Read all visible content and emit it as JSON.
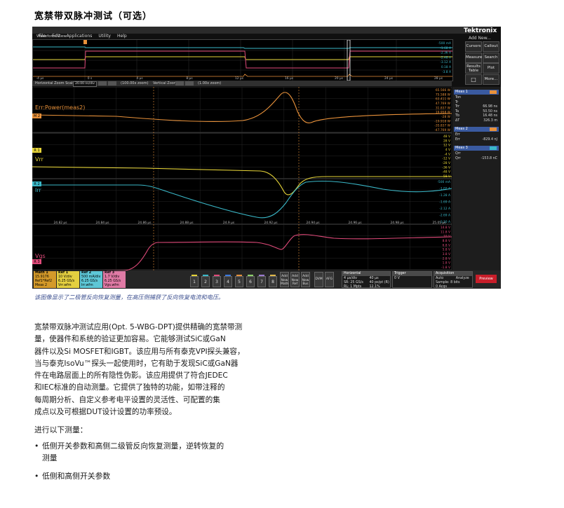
{
  "page": {
    "title": "宽禁带双脉冲测试（可选）",
    "caption": "该图像显示了二极管反向恢复测量，在高压侧捕获了反向恢复电流和电压。",
    "paragraph_lines": [
      "宽禁带双脉冲测试应用(Opt. 5-WBG-DPT)提供精确的宽禁带测",
      "量，使器件和系统的验证更加容易。它能够测试SiC或GaN",
      "器件以及Si MOSFET和IGBT。该应用与所有泰克VPI探头兼容，",
      "当与泰克IsoVu™探头一起使用时，它有助于发现SiC或GaN器",
      "件在电路层面上的所有隐性伪影。该应用提供了符合JEDEC",
      "和IEC标准的自动测量。它提供了独特的功能，如带注释的",
      "每周期分析、自定义参考电平设置的灵活性、可配置的集",
      "成点以及可根据DUT设计设置的功率预设。"
    ],
    "measure_intro": "进行以下测量：",
    "bullets": [
      {
        "dot": "•",
        "lines": [
          "低侧开关参数和高侧二级管反向恢复测量，逆转恢复的",
          "测量"
        ]
      },
      {
        "dot": "•",
        "lines": [
          "低侧和高侧开关参数"
        ]
      }
    ]
  },
  "scope": {
    "menu": [
      "File",
      "Edit",
      "Applications",
      "Utility",
      "Help"
    ],
    "logo": "Tektronix",
    "add_new": "Add New...",
    "right_buttons": [
      "Cursors",
      "Callout",
      "Measure",
      "Search",
      "Results Table",
      "Plot",
      "More..."
    ],
    "waveform_view_label": "Waveform View",
    "wf_time_ticks": [
      "-4 μs",
      "0 s",
      "4 μs",
      "8 μs",
      "12 μs",
      "16 μs",
      "20 μs",
      "24 μs",
      "28 μs"
    ],
    "wf_right_labels": [
      "-500 mA",
      "-1.68 A",
      "-2.36 A",
      "-2.48 A",
      "-3.12 A",
      "0.18 A",
      "-3.8 A"
    ],
    "zoom_bar": {
      "hzoom_label": "Horizontal Zoom Scale",
      "hzoom_value": "20.00 ns/div",
      "pos_label": "(100.00x zoom)",
      "vzoom_label": "Vertical Zoom",
      "vzoom_value": "(1.00x zoom)"
    },
    "panels": [
      {
        "name": "Err:Power(meas2)",
        "marker": "M 2",
        "color": "#e8913a",
        "y_labels": [
          "65.566 W",
          "75.588 W",
          "63.411 W",
          "47.769 W",
          "31.837 W",
          "19.958 W",
          "-28 W",
          "-19.918 W",
          "-35.837 W",
          "-47.769 W"
        ]
      },
      {
        "name": "Vrr",
        "marker": "R 1",
        "color": "#e6d438",
        "y_labels": [
          "48 V",
          "28 V",
          "12 V",
          "4 V",
          "-4 V",
          "-12 V",
          "-28 V",
          "-36 V",
          "-48 V",
          "-58 V"
        ]
      },
      {
        "name": "Irr",
        "marker": "R 2",
        "color": "#3ab8c8",
        "y_labels": [
          "-500 mA",
          "-1.02 A",
          "-1.28 A",
          "-1.69 A",
          "-2.12 A",
          "-2.69 A",
          "-3.10 A"
        ],
        "time_ticks": [
          "24.82 μs",
          "24.84 μs",
          "24.86 μs",
          "24.88 μs",
          "24.9 μs",
          "24.92 μs",
          "24.94 μs",
          "24.96 μs",
          "24.98 μs",
          "25.01 μs"
        ]
      },
      {
        "name": "Vgs",
        "marker": "R 3",
        "color": "#e04a7a",
        "y_labels": [
          "14.8 V",
          "11.8 V",
          "10 V",
          "8.8 V",
          "6.8 V",
          "5.8 V",
          "3.8 V",
          "2.8 V",
          "1.8 V",
          "-1.8 V"
        ]
      }
    ],
    "meas_panel": [
      {
        "title": "Meas 1",
        "color": "#e8913a",
        "rows": [
          {
            "k": "Ton",
            "v": ""
          },
          {
            "k": "Tr",
            "v": ""
          },
          {
            "k": "Trr",
            "v": "66.98 ns"
          },
          {
            "k": "Ta",
            "v": "50.50 ns"
          },
          {
            "k": "Tb",
            "v": "16.48 ns"
          },
          {
            "k": "ΔT",
            "v": "326.3 m"
          }
        ]
      },
      {
        "title": "Meas 2",
        "color": "#e8913a",
        "rows": [
          {
            "k": "Err",
            "v": ""
          },
          {
            "k": "Err",
            "v": "-829.4 nJ"
          }
        ]
      },
      {
        "title": "Meas 3",
        "color": "#3ab8c8",
        "rows": [
          {
            "k": "Qrr",
            "v": ""
          },
          {
            "k": "Qrr",
            "v": "-153.8 nC"
          }
        ]
      }
    ],
    "bottom": {
      "chips": [
        {
          "title": "Math 1",
          "bg": "#d49a2a",
          "lines": [
            "15.9176",
            "Ref1*Ref2",
            "Meas 2"
          ]
        },
        {
          "title": "Ref 1",
          "bg": "#e4cf40",
          "lines": [
            "10 V/div",
            "6.25 GS/s",
            "Vrr.wfm"
          ]
        },
        {
          "title": "Ref 2",
          "bg": "#5ec7d6",
          "lines": [
            "500 mA/div",
            "6.25 GS/s",
            "Irr.wfm"
          ]
        },
        {
          "title": "Ref 3",
          "bg": "#e07aa5",
          "lines": [
            "1.7 V/div",
            "6.25 GS/s",
            "Vgs.wfm"
          ]
        }
      ],
      "channel_buttons": [
        "1",
        "2",
        "3",
        "4",
        "5",
        "6",
        "7",
        "8"
      ],
      "channel_caps": [
        "#e6d438",
        "#3ab8c8",
        "#e04a7a",
        "#3a7ae0",
        "#e8913a",
        "#8ed16a",
        "#9a7ad0",
        "#e0b84a"
      ],
      "add_buttons": [
        {
          "lines": [
            "Add",
            "New",
            "Math"
          ]
        },
        {
          "lines": [
            "Add",
            "New",
            "Ref"
          ]
        },
        {
          "lines": [
            "Add",
            "New",
            "Bus"
          ]
        }
      ],
      "misc_buttons": [
        "DVM",
        "AFG"
      ],
      "horizontal": {
        "title": "Horizontal",
        "lines": [
          "4 μs/div",
          "SR: 25 GS/s",
          "RL: 1 Mpts"
        ],
        "lines2": [
          "40 μs",
          "40 ps/pt (R)",
          "12.1%"
        ]
      },
      "trigger": {
        "title": "Trigger",
        "lines": [
          "0 V"
        ]
      },
      "acquisition": {
        "title": "Acquisition",
        "lines": [
          "Auto",
          "Sample: 8 bits",
          "0 Acqs"
        ],
        "lines2": [
          "Analyze"
        ]
      },
      "preview": "Preview"
    }
  }
}
